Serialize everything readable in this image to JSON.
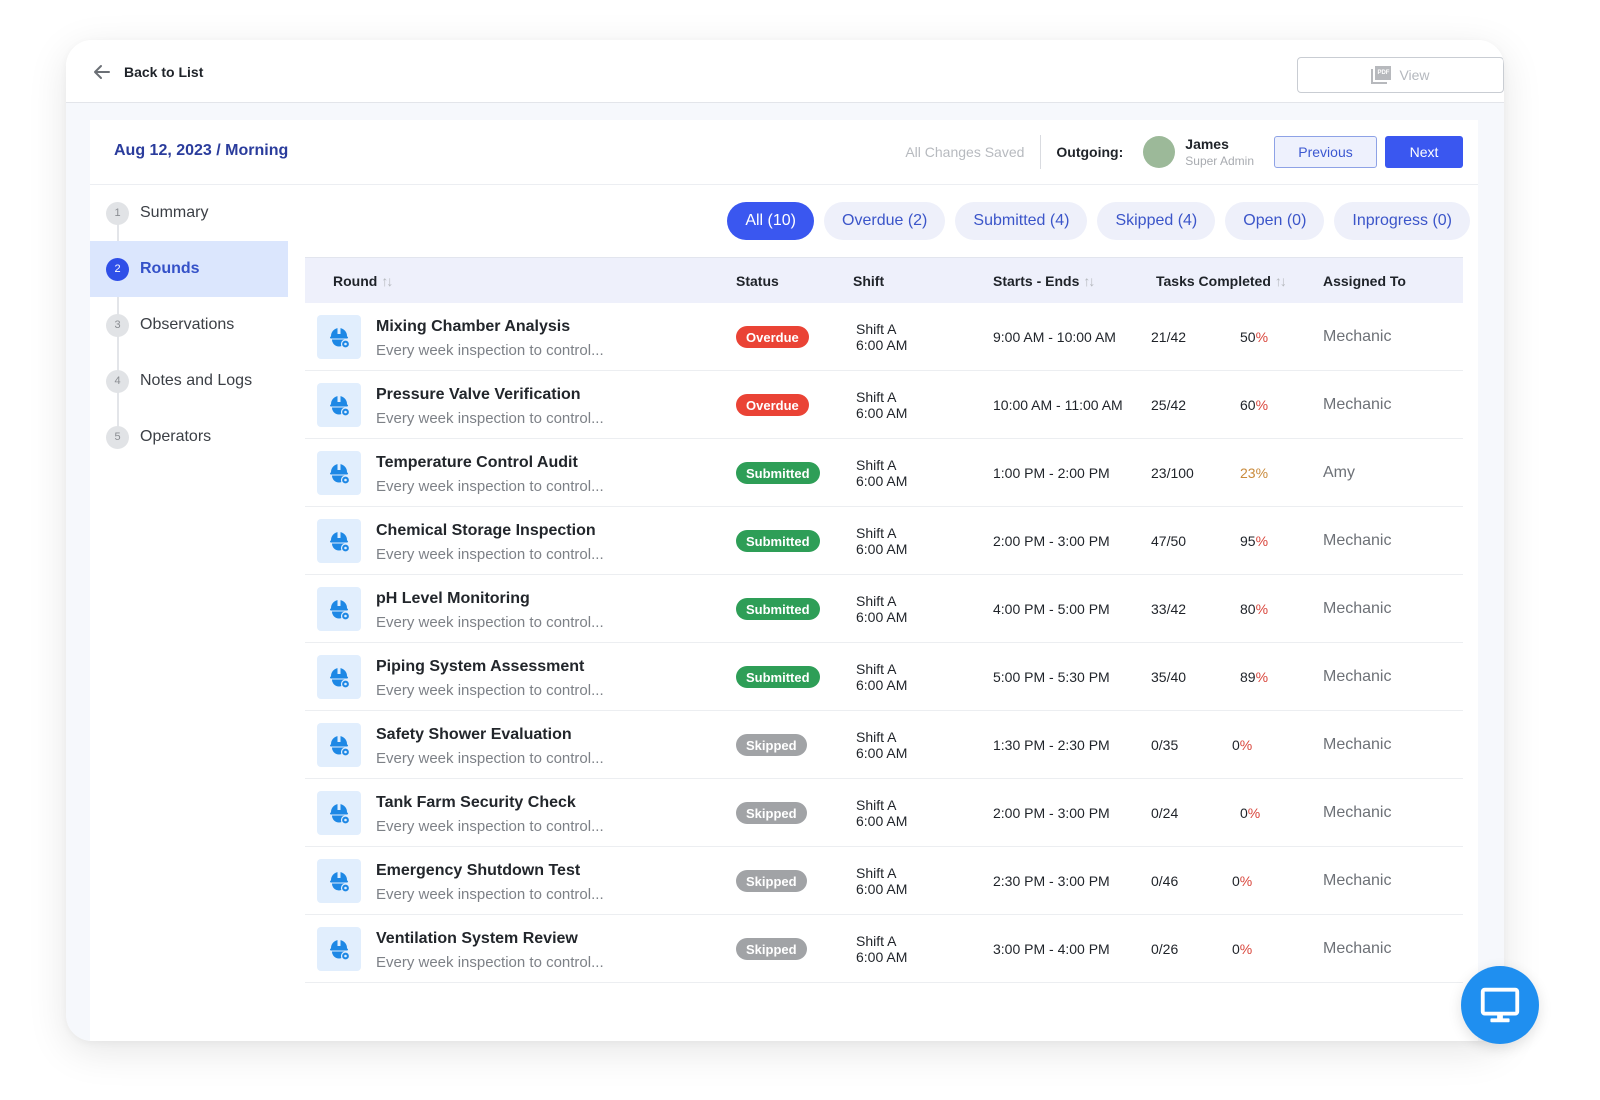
{
  "topbar": {
    "back_label": "Back to List",
    "view_label": "View",
    "view_icon_text": "PDF"
  },
  "header": {
    "title": "Aug 12, 2023 / Morning",
    "save_status": "All Changes Saved",
    "outgoing_label": "Outgoing:",
    "user_name": "James",
    "user_role": "Super Admin",
    "avatar_color": "#9cb999",
    "previous_label": "Previous",
    "next_label": "Next"
  },
  "steps": [
    {
      "num": "1",
      "label": "Summary",
      "active": false
    },
    {
      "num": "2",
      "label": "Rounds",
      "active": true
    },
    {
      "num": "3",
      "label": "Observations",
      "active": false
    },
    {
      "num": "4",
      "label": "Notes and Logs",
      "active": false
    },
    {
      "num": "5",
      "label": "Operators",
      "active": false
    }
  ],
  "tabs": [
    {
      "label": "All (10)",
      "active": true
    },
    {
      "label": "Overdue (2)",
      "active": false
    },
    {
      "label": "Submitted (4)",
      "active": false
    },
    {
      "label": "Skipped (4)",
      "active": false
    },
    {
      "label": "Open (0)",
      "active": false
    },
    {
      "label": "Inprogress (0)",
      "active": false
    }
  ],
  "table": {
    "columns": {
      "round": "Round",
      "status": "Status",
      "shift": "Shift",
      "starts_ends": "Starts - Ends",
      "tasks_completed": "Tasks Completed",
      "assigned_to": "Assigned To"
    },
    "rows": [
      {
        "title": "Mixing Chamber Analysis",
        "desc": "Every week inspection to control...",
        "status": "Overdue",
        "status_type": "overdue",
        "shift": "Shift A",
        "shift_time": "6:00 AM",
        "time_range": "9:00 AM - 10:00 AM",
        "tasks": "21/42",
        "pct": "50",
        "pct_sign": "%",
        "assigned": "Mechanic"
      },
      {
        "title": "Pressure Valve Verification",
        "desc": "Every week inspection to control...",
        "status": "Overdue",
        "status_type": "overdue",
        "shift": "Shift A",
        "shift_time": "6:00 AM",
        "time_range": "10:00 AM - 11:00 AM",
        "tasks": "25/42",
        "pct": "60",
        "pct_sign": "%",
        "assigned": "Mechanic"
      },
      {
        "title": "Temperature Control Audit",
        "desc": "Every week inspection to control...",
        "status": "Submitted",
        "status_type": "submitted",
        "shift": "Shift A",
        "shift_time": "6:00 AM",
        "time_range": "1:00 PM - 2:00 PM",
        "tasks": "23/100",
        "pct": "23 ",
        "pct_sign": "%",
        "pct_low": true,
        "assigned": "Amy"
      },
      {
        "title": "Chemical Storage Inspection",
        "desc": "Every week inspection to control...",
        "status": "Submitted",
        "status_type": "submitted",
        "shift": "Shift A",
        "shift_time": "6:00 AM",
        "time_range": "2:00 PM - 3:00 PM",
        "tasks": "47/50",
        "pct": "95",
        "pct_sign": "%",
        "assigned": "Mechanic"
      },
      {
        "title": "pH Level Monitoring",
        "desc": "Every week inspection to control...",
        "status": "Submitted",
        "status_type": "submitted",
        "shift": "Shift A",
        "shift_time": "6:00 AM",
        "time_range": "4:00 PM - 5:00 PM",
        "tasks": "33/42",
        "pct": "80",
        "pct_sign": "%",
        "assigned": "Mechanic"
      },
      {
        "title": "Piping System Assessment",
        "desc": "Every week inspection to control...",
        "status": "Submitted",
        "status_type": "submitted",
        "shift": "Shift A",
        "shift_time": "6:00 AM",
        "time_range": "5:00 PM - 5:30 PM",
        "tasks": "35/40",
        "pct": "89",
        "pct_sign": "%",
        "assigned": "Mechanic"
      },
      {
        "title": "Safety Shower Evaluation",
        "desc": "Every week inspection to control...",
        "status": "Skipped",
        "status_type": "skipped",
        "shift": "Shift A",
        "shift_time": "6:00 AM",
        "time_range": "1:30 PM - 2:30 PM",
        "tasks": "0/35",
        "pct": "0",
        "pct_sign": "%",
        "assigned": "Mechanic"
      },
      {
        "title": "Tank Farm Security Check",
        "desc": "Every week inspection to control...",
        "status": "Skipped",
        "status_type": "skipped",
        "shift": "Shift A",
        "shift_time": "6:00 AM",
        "time_range": "2:00 PM - 3:00 PM",
        "tasks": "0/24",
        "pct": "0",
        "pct_sign": "%",
        "assigned": "Mechanic"
      },
      {
        "title": "Emergency Shutdown Test",
        "desc": "Every week inspection to control...",
        "status": "Skipped",
        "status_type": "skipped",
        "shift": "Shift A",
        "shift_time": "6:00 AM",
        "time_range": "2:30 PM - 3:00 PM",
        "tasks": "0/46",
        "pct": "0",
        "pct_sign": "%",
        "assigned": "Mechanic"
      },
      {
        "title": "Ventilation System Review",
        "desc": "Every week inspection to control...",
        "status": "Skipped",
        "status_type": "skipped",
        "shift": "Shift A",
        "shift_time": "6:00 AM",
        "time_range": "3:00 PM - 4:00 PM",
        "tasks": "0/26",
        "pct": "0",
        "pct_sign": "%",
        "assigned": "Mechanic"
      }
    ]
  },
  "icons": {
    "back": "arrow-left-icon",
    "view": "pdf-icon",
    "row": "hard-hat-icon",
    "sort": "sort-icon",
    "fab": "monitor-icon"
  },
  "colors": {
    "primary": "#3a57f0",
    "title": "#2a3c9c",
    "overdue": "#ea4335",
    "submitted": "#2e9e57",
    "skipped": "#a1a3a6",
    "fab": "#1f8ff0"
  }
}
